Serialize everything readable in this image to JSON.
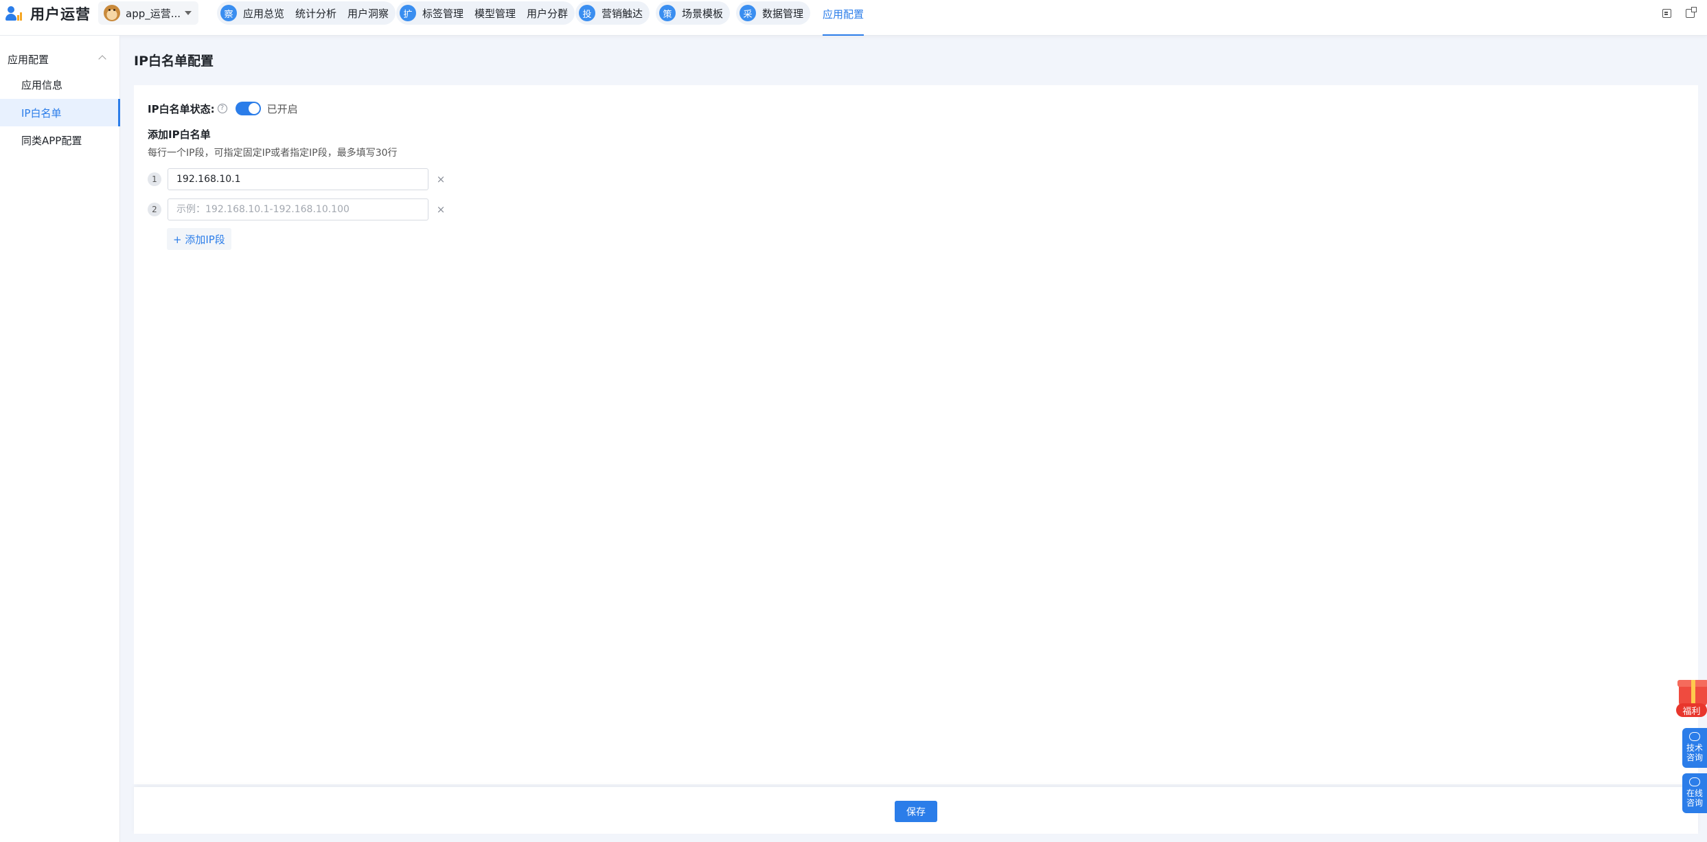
{
  "header": {
    "logo_text": "用户运营",
    "app_name": "app_运营...",
    "nav_groups": [
      {
        "badge": "察",
        "items": [
          "应用总览",
          "统计分析",
          "用户洞察"
        ]
      },
      {
        "badge": "扩",
        "items": [
          "标签管理",
          "模型管理",
          "用户分群"
        ]
      },
      {
        "badge": "投",
        "items": [
          "营销触达"
        ]
      },
      {
        "badge": "策",
        "items": [
          "场景模板"
        ]
      },
      {
        "badge": "采",
        "items": [
          "数据管理"
        ]
      }
    ],
    "active_nav": "应用配置"
  },
  "sidebar": {
    "group_label": "应用配置",
    "items": [
      {
        "label": "应用信息"
      },
      {
        "label": "IP白名单"
      },
      {
        "label": "同类APP配置"
      }
    ],
    "active_index": 1
  },
  "main": {
    "title": "IP白名单配置",
    "status_label": "IP白名单状态:",
    "help_symbol": "?",
    "status_on": true,
    "status_text": "已开启",
    "section_title": "添加IP白名单",
    "section_desc": "每行一个IP段，可指定固定IP或者指定IP段，最多填写30行",
    "ip_rows": [
      {
        "num": "1",
        "value": "192.168.10.1",
        "placeholder": ""
      },
      {
        "num": "2",
        "value": "",
        "placeholder": "示例：192.168.10.1-192.168.10.100"
      }
    ],
    "delete_symbol": "×",
    "add_label": "+ 添加IP段",
    "save_label": "保存"
  },
  "floating": {
    "gift_label": "福利",
    "tech_label": "技术咨询",
    "online_label": "在线咨询"
  },
  "colors": {
    "primary": "#2b7de9",
    "page_bg": "#f2f5fb",
    "gift": "#e8362c"
  }
}
